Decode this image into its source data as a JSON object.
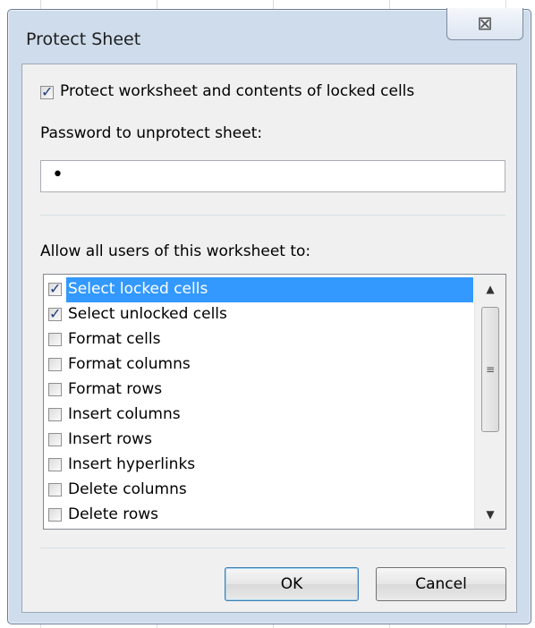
{
  "dialog": {
    "title": "Protect Sheet",
    "close_glyph": "⊠",
    "protect_checkbox": {
      "label": "Protect worksheet and contents of locked cells",
      "checked": true
    },
    "password": {
      "label": "Password to unprotect sheet:",
      "masked_value": "•"
    },
    "allow_label": "Allow all users of this worksheet to:",
    "permissions": [
      {
        "label": "Select locked cells",
        "checked": true,
        "selected": true
      },
      {
        "label": "Select unlocked cells",
        "checked": true,
        "selected": false
      },
      {
        "label": "Format cells",
        "checked": false,
        "selected": false
      },
      {
        "label": "Format columns",
        "checked": false,
        "selected": false
      },
      {
        "label": "Format rows",
        "checked": false,
        "selected": false
      },
      {
        "label": "Insert columns",
        "checked": false,
        "selected": false
      },
      {
        "label": "Insert rows",
        "checked": false,
        "selected": false
      },
      {
        "label": "Insert hyperlinks",
        "checked": false,
        "selected": false
      },
      {
        "label": "Delete columns",
        "checked": false,
        "selected": false
      },
      {
        "label": "Delete rows",
        "checked": false,
        "selected": false
      }
    ],
    "ok_label": "OK",
    "cancel_label": "Cancel"
  },
  "colors": {
    "dialog_frame": "#cfdcec",
    "selection": "#3399ff",
    "check": "#1d3c7a"
  },
  "icons": {
    "close": "close-icon",
    "check": "checkmark-icon",
    "scroll_up": "scroll-up-arrow-icon",
    "scroll_down": "scroll-down-arrow-icon",
    "grip": "scroll-grip-icon"
  }
}
